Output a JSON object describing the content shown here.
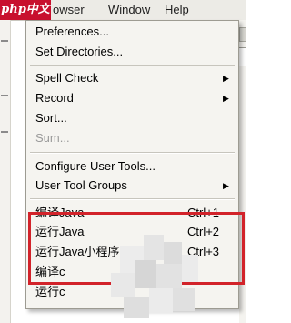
{
  "menubar": {
    "logo_text": "php中文网",
    "browser_fragment": "owser",
    "window": "Window",
    "help": "Help"
  },
  "menu": {
    "preferences": "Preferences...",
    "set_directories": "Set Directories...",
    "spell_check": "Spell Check",
    "record": "Record",
    "sort": "Sort...",
    "sum": "Sum...",
    "configure_user_tools": "Configure User Tools...",
    "user_tool_groups": "User Tool Groups",
    "tools": [
      {
        "label": "编译Java",
        "shortcut": "Ctrl+1"
      },
      {
        "label": "运行Java",
        "shortcut": "Ctrl+2"
      },
      {
        "label": "运行Java小程序",
        "shortcut": "Ctrl+3"
      },
      {
        "label": "编译c",
        "shortcut": ""
      },
      {
        "label": "运行c",
        "shortcut": ""
      }
    ]
  },
  "colors": {
    "highlight_border": "#d2232a",
    "logo_background": "#c8102e"
  },
  "icons": {
    "submenu_arrow": "submenu-arrow-icon"
  }
}
